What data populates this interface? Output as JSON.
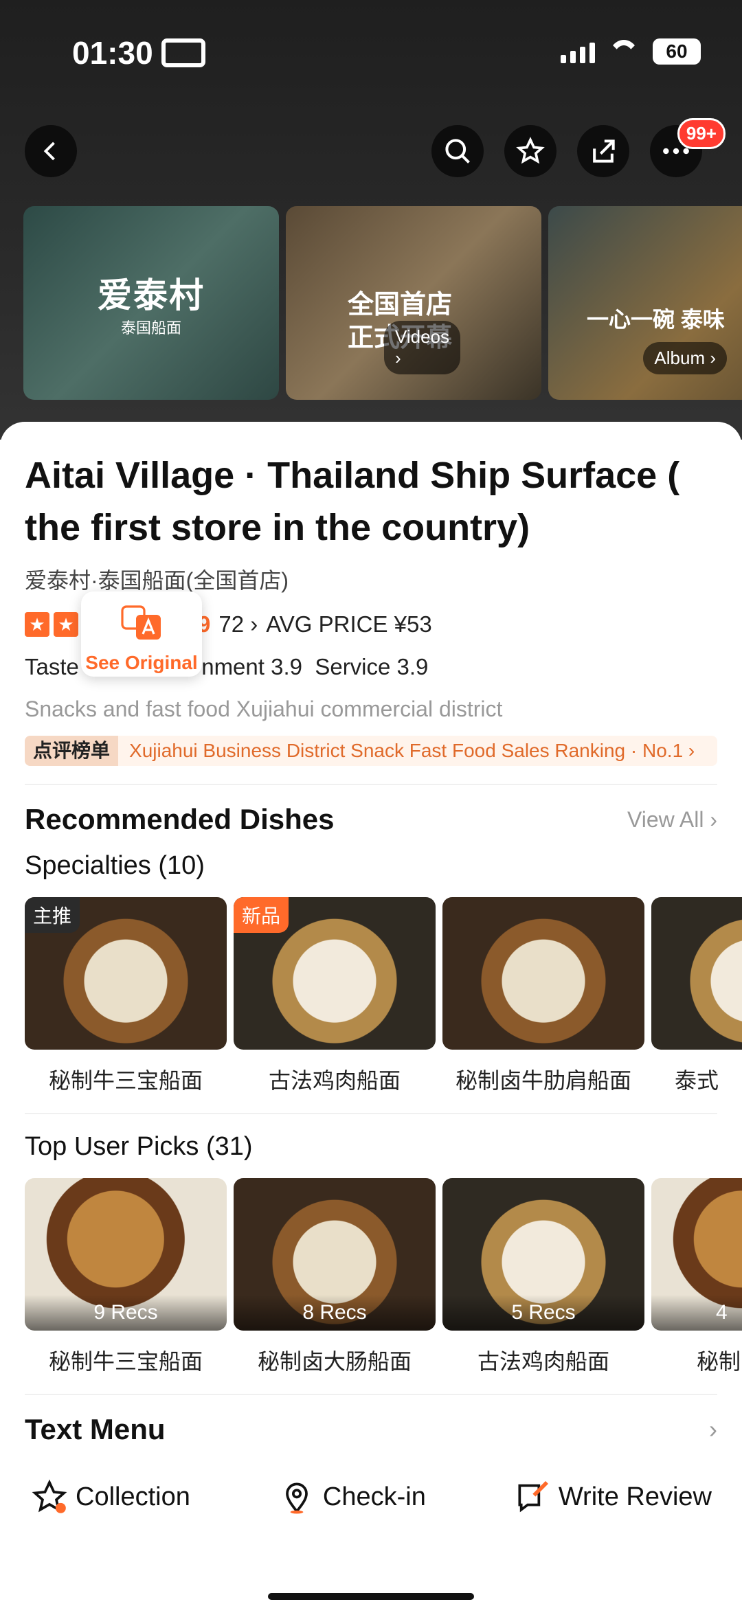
{
  "status_bar": {
    "time": "01:30",
    "battery": "60"
  },
  "topbar": {
    "badge": "99+"
  },
  "gallery": {
    "tiles": [
      {
        "big": "爱泰村",
        "sub": "泰国船面"
      },
      {
        "big": "全国首店\n正式开幕"
      },
      {
        "big": "一心一碗 泰味"
      }
    ],
    "videos_label": "Videos ›",
    "album_label": "Album ›"
  },
  "restaurant": {
    "title": "Aitai Village · Thailand Ship Surface ( the first store in the country)",
    "original_name": "爱泰村·泰国船面(全国首店)",
    "score": "9",
    "reviews": "72 ›",
    "avg_price": "AVG PRICE ¥53",
    "taste": "Taste",
    "environment": "nment 3.9",
    "service": "Service 3.9",
    "category": "Snacks and fast food  Xujiahui commercial district",
    "rank_tag": "点评榜单",
    "rank_text": "Xujiahui Business District Snack Fast Food Sales Ranking · No.1 ›"
  },
  "see_original": {
    "label": "See Original"
  },
  "recommended": {
    "title": "Recommended Dishes",
    "view_all": "View All ›",
    "specialties_title": "Specialties (10)",
    "specialties": [
      {
        "tag": "主推",
        "name": "秘制牛三宝船面"
      },
      {
        "tag": "新品",
        "name": "古法鸡肉船面"
      },
      {
        "tag": "",
        "name": "秘制卤牛肋肩船面"
      },
      {
        "tag": "",
        "name": "泰式"
      }
    ],
    "top_picks_title": "Top User Picks (31)",
    "top_picks": [
      {
        "recs": "9 Recs",
        "name": "秘制牛三宝船面"
      },
      {
        "recs": "8 Recs",
        "name": "秘制卤大肠船面"
      },
      {
        "recs": "5 Recs",
        "name": "古法鸡肉船面"
      },
      {
        "recs": "4",
        "name": "秘制"
      }
    ]
  },
  "text_menu": {
    "title": "Text Menu"
  },
  "actions": {
    "collection": "Collection",
    "checkin": "Check-in",
    "write_review": "Write Review"
  },
  "colors": {
    "accent": "#ff6a2a",
    "badge": "#ff3b30"
  }
}
